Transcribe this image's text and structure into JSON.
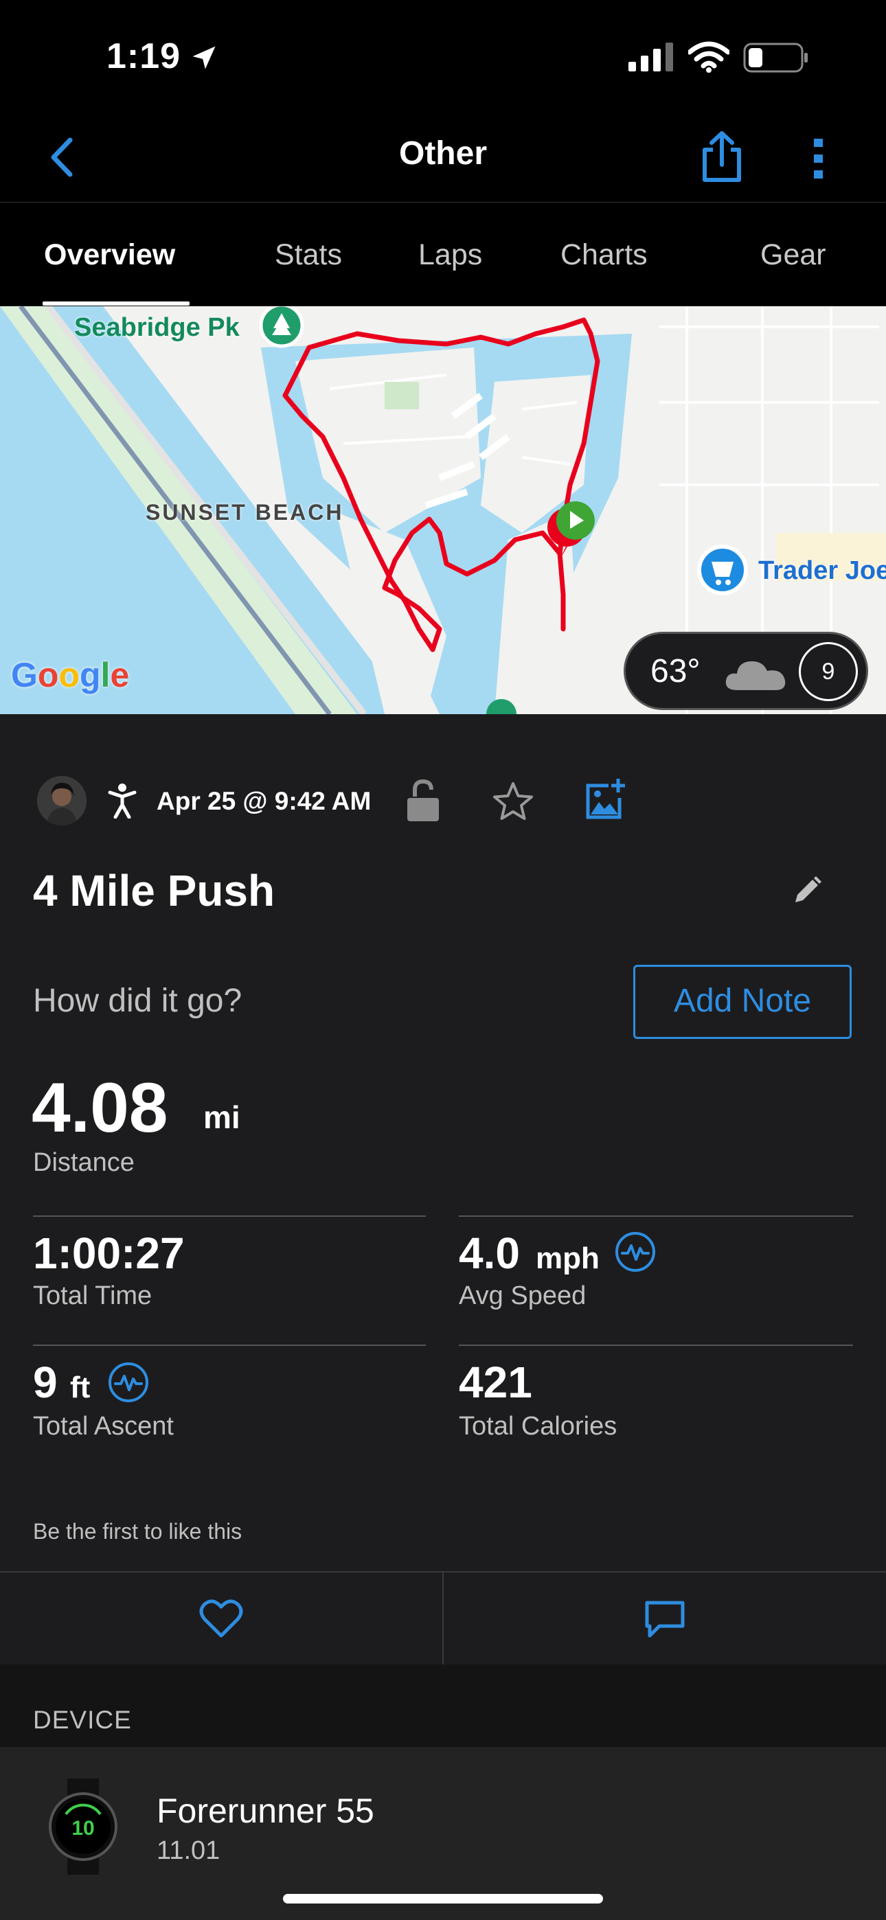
{
  "status_bar": {
    "time": "1:19"
  },
  "nav": {
    "title": "Other"
  },
  "tabs": [
    "Overview",
    "Stats",
    "Laps",
    "Charts",
    "Gear"
  ],
  "map": {
    "labels": {
      "park": "Seabridge Pk",
      "area": "SUNSET BEACH",
      "store": "Trader Joe",
      "google": "Google"
    },
    "weather": {
      "temp": "63°",
      "wind": "9"
    }
  },
  "activity": {
    "date": "Apr 25 @ 9:42 AM",
    "title": "4 Mile Push",
    "prompt": "How did it go?",
    "add_note": "Add Note"
  },
  "stats": {
    "distance": {
      "value": "4.08",
      "unit": "mi",
      "label": "Distance"
    },
    "total_time": {
      "value": "1:00:27",
      "label": "Total Time"
    },
    "avg_speed": {
      "value": "4.0",
      "unit": "mph",
      "label": "Avg Speed"
    },
    "total_ascent": {
      "value": "9",
      "unit": "ft",
      "label": "Total Ascent"
    },
    "total_calories": {
      "value": "421",
      "label": "Total Calories"
    }
  },
  "social": {
    "like_text": "Be the first to like this"
  },
  "device": {
    "section_label": "DEVICE",
    "name": "Forerunner 55",
    "version": "11.01",
    "watch_face": "10"
  },
  "colors": {
    "accent": "#2e8de0",
    "route": "#e8001c",
    "start_marker": "#3fa535",
    "background": "#1c1c1e"
  }
}
